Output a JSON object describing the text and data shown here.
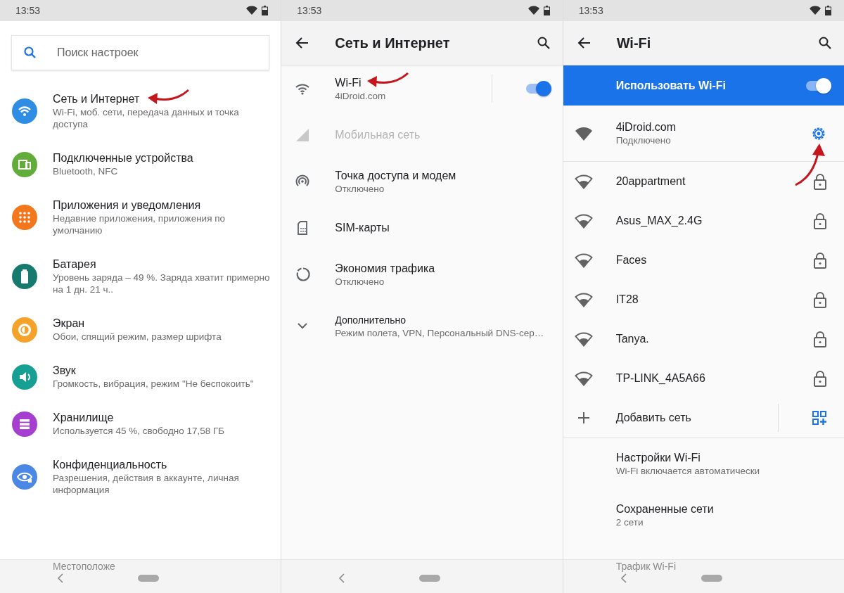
{
  "settings_screen": {
    "status_bar": {
      "time": "13:53"
    },
    "search": {
      "placeholder": "Поиск настроек"
    },
    "items": [
      {
        "title": "Сеть и Интернет",
        "subtitle": "Wi-Fi, моб. сети, передача данных и точка доступа",
        "color": "#2f8de4"
      },
      {
        "title": "Подключенные устройства",
        "subtitle": "Bluetooth, NFC",
        "color": "#62ad3a"
      },
      {
        "title": "Приложения и уведомления",
        "subtitle": "Недавние приложения, приложения по умолчанию",
        "color": "#f4771e"
      },
      {
        "title": "Батарея",
        "subtitle": "Уровень заряда – 49 %. Заряда хватит примерно на 1 дн. 21 ч..",
        "color": "#177a6e"
      },
      {
        "title": "Экран",
        "subtitle": "Обои, спящий режим, размер шрифта",
        "color": "#f4a22a"
      },
      {
        "title": "Звук",
        "subtitle": "Громкость, вибрация, режим \"Не беспокоить\"",
        "color": "#16a093"
      },
      {
        "title": "Хранилище",
        "subtitle": "Используется 45 %, свободно 17,58 ГБ",
        "color": "#a63ed0"
      },
      {
        "title": "Конфиденциальность",
        "subtitle": "Разрешения, действия в аккаунте, личная информация",
        "color": "#4b88e6"
      }
    ],
    "peek": "Местоположе"
  },
  "network_screen": {
    "status_bar": {
      "time": "13:53"
    },
    "title": "Сеть и Интернет",
    "items": [
      {
        "kind": "switch",
        "title": "Wi-Fi",
        "subtitle": "4iDroid.com",
        "on": true,
        "disabled": false
      },
      {
        "kind": "plain",
        "title": "Мобильная сеть",
        "disabled": true
      },
      {
        "kind": "plain",
        "title": "Точка доступа и модем",
        "subtitle": "Отключено",
        "disabled": false
      },
      {
        "kind": "plain",
        "title": "SIM-карты",
        "disabled": false
      },
      {
        "kind": "plain",
        "title": "Экономия трафика",
        "subtitle": "Отключено",
        "disabled": false
      },
      {
        "kind": "expand",
        "title": "Дополнительно",
        "subtitle": "Режим полета, VPN, Персональный DNS-сер…",
        "disabled": false
      }
    ]
  },
  "wifi_screen": {
    "status_bar": {
      "time": "13:53"
    },
    "title": "Wi-Fi",
    "master": {
      "label": "Использовать Wi-Fi",
      "on": true
    },
    "networks": [
      {
        "kind": "connected",
        "name": "4iDroid.com",
        "status": "Подключено"
      },
      {
        "kind": "locked",
        "name": "20appartment"
      },
      {
        "kind": "locked",
        "name": "Asus_MAX_2.4G"
      },
      {
        "kind": "locked",
        "name": "Faces"
      },
      {
        "kind": "locked",
        "name": "IT28"
      },
      {
        "kind": "locked",
        "name": "Tanya."
      },
      {
        "kind": "locked",
        "name": "TP-LINK_4A5A66"
      }
    ],
    "add_network": {
      "label": "Добавить сеть"
    },
    "settings": [
      {
        "title": "Настройки Wi-Fi",
        "subtitle": "Wi-Fi включается автоматически"
      },
      {
        "title": "Сохраненные сети",
        "subtitle": "2 сети"
      }
    ],
    "peek": "Трафик Wi-Fi"
  }
}
